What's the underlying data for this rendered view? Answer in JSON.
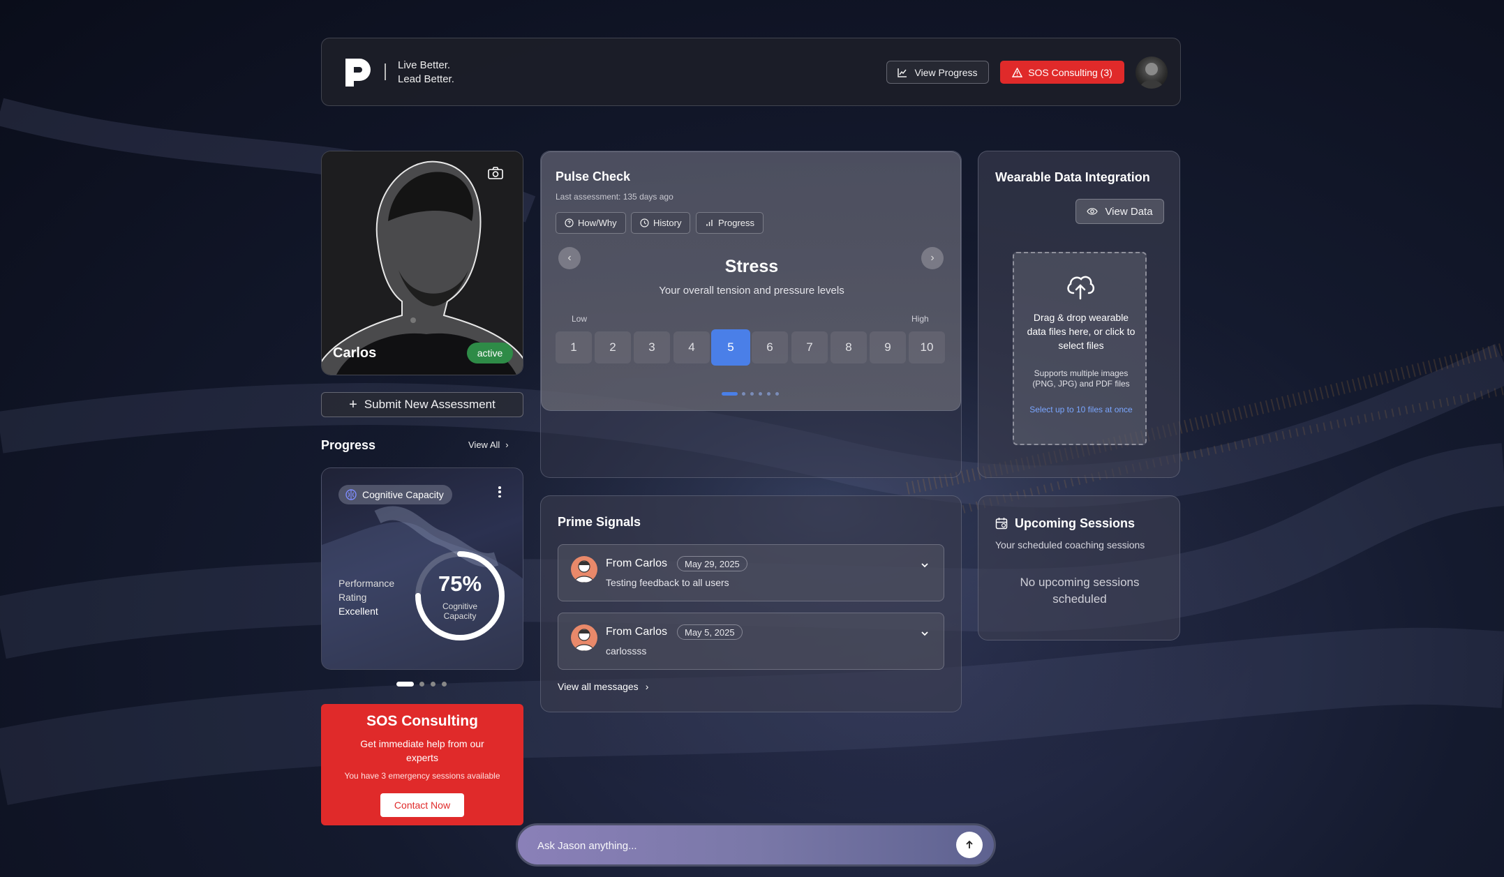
{
  "header": {
    "tagline_line1": "Live Better.",
    "tagline_line2": "Lead Better.",
    "view_progress_label": "View Progress",
    "sos_label": "SOS Consulting (3)"
  },
  "profile": {
    "name": "Carlos",
    "status": "active",
    "submit_label": "Submit New Assessment"
  },
  "progress": {
    "title": "Progress",
    "view_all": "View All",
    "card": {
      "tag": "Cognitive Capacity",
      "rating_line1": "Performance",
      "rating_line2": "Rating",
      "rating_value": "Excellent",
      "percent_text": "75%",
      "percent_value": 0.75,
      "gauge_label_line1": "Cognitive",
      "gauge_label_line2": "Capacity"
    }
  },
  "sos_card": {
    "title": "SOS Consulting",
    "subtitle": "Get immediate help from our experts",
    "note": "You have 3 emergency sessions available",
    "button": "Contact Now"
  },
  "pulse": {
    "title": "Pulse Check",
    "last_assessment": "Last assessment: 135 days ago",
    "tabs": [
      "How/Why",
      "History",
      "Progress"
    ],
    "metric": "Stress",
    "metric_desc": "Your overall tension and pressure levels",
    "low_label": "Low",
    "high_label": "High",
    "scale": [
      "1",
      "2",
      "3",
      "4",
      "5",
      "6",
      "7",
      "8",
      "9",
      "10"
    ],
    "selected": "5"
  },
  "wearable": {
    "title": "Wearable Data Integration",
    "view_data": "View Data",
    "drop_text": "Drag & drop wearable data files here, or click to select files",
    "supports": "Supports multiple images (PNG, JPG) and PDF files",
    "limit": "Select up to 10 files at once"
  },
  "signals": {
    "title": "Prime Signals",
    "items": [
      {
        "from": "From Carlos",
        "date": "May 29, 2025",
        "message": "Testing feedback to all users"
      },
      {
        "from": "From Carlos",
        "date": "May 5, 2025",
        "message": "carlossss"
      }
    ],
    "view_all": "View all messages"
  },
  "sessions": {
    "title": "Upcoming Sessions",
    "subtitle": "Your scheduled coaching sessions",
    "empty": "No upcoming sessions scheduled"
  },
  "chat": {
    "placeholder": "Ask Jason anything..."
  },
  "colors": {
    "accent_blue": "#4a7fe8",
    "sos_red": "#e02a2a",
    "active_green": "#2e8b47",
    "link_blue": "#7aa6ff"
  }
}
